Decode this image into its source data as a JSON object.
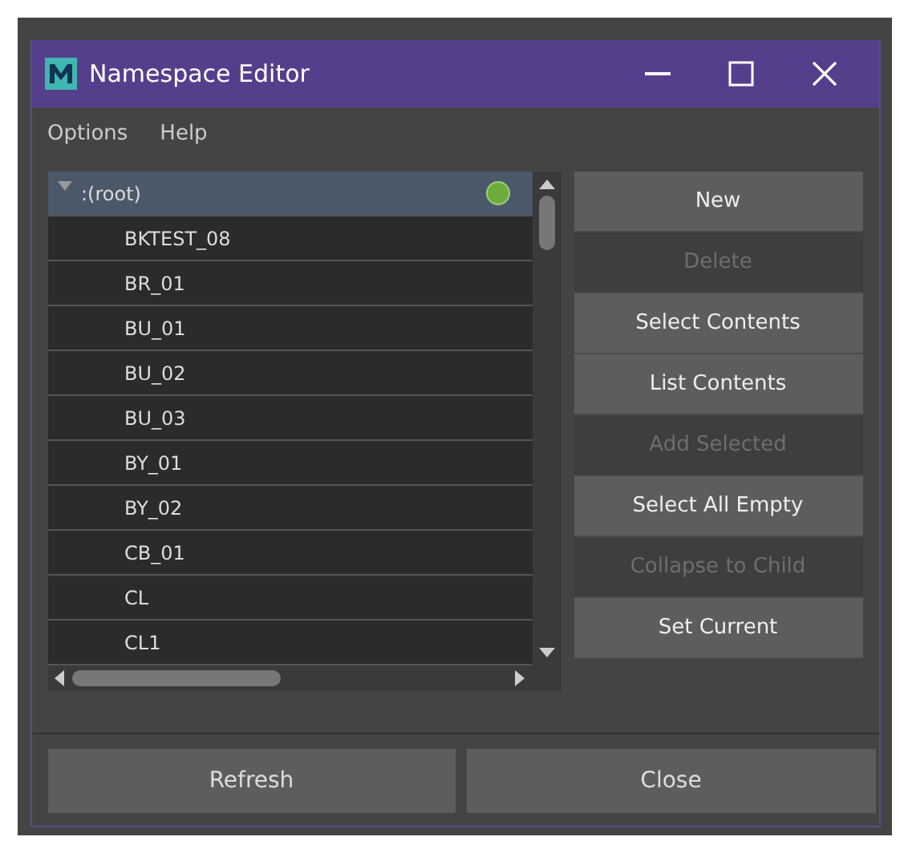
{
  "window": {
    "title": "Namespace Editor"
  },
  "menu": [
    "Options",
    "Help"
  ],
  "tree": {
    "items": [
      {
        "label": ":(root)",
        "expanded": true,
        "selected": true,
        "current": true,
        "children": [
          {
            "label": "BKTEST_08",
            "selected": false,
            "current": false
          },
          {
            "label": "BR_01",
            "selected": false,
            "current": false
          },
          {
            "label": "BU_01",
            "selected": false,
            "current": false
          },
          {
            "label": "BU_02",
            "selected": false,
            "current": false
          },
          {
            "label": "BU_03",
            "selected": false,
            "current": false
          },
          {
            "label": "BY_01",
            "selected": false,
            "current": false
          },
          {
            "label": "BY_02",
            "selected": false,
            "current": false
          },
          {
            "label": "CB_01",
            "selected": false,
            "current": false
          },
          {
            "label": "CL",
            "selected": false,
            "current": false
          },
          {
            "label": "CL1",
            "selected": false,
            "current": false
          }
        ]
      }
    ]
  },
  "actions": [
    {
      "label": "New",
      "disabled": false
    },
    {
      "label": "Delete",
      "disabled": true
    },
    {
      "label": "Select Contents",
      "disabled": false
    },
    {
      "label": "List Contents",
      "disabled": false
    },
    {
      "label": "Add Selected",
      "disabled": true
    },
    {
      "label": "Select All Empty",
      "disabled": false
    },
    {
      "label": "Collapse to Child",
      "disabled": true
    },
    {
      "label": "Set Current",
      "disabled": false
    }
  ],
  "footer_buttons": [
    "Refresh",
    "Close"
  ]
}
